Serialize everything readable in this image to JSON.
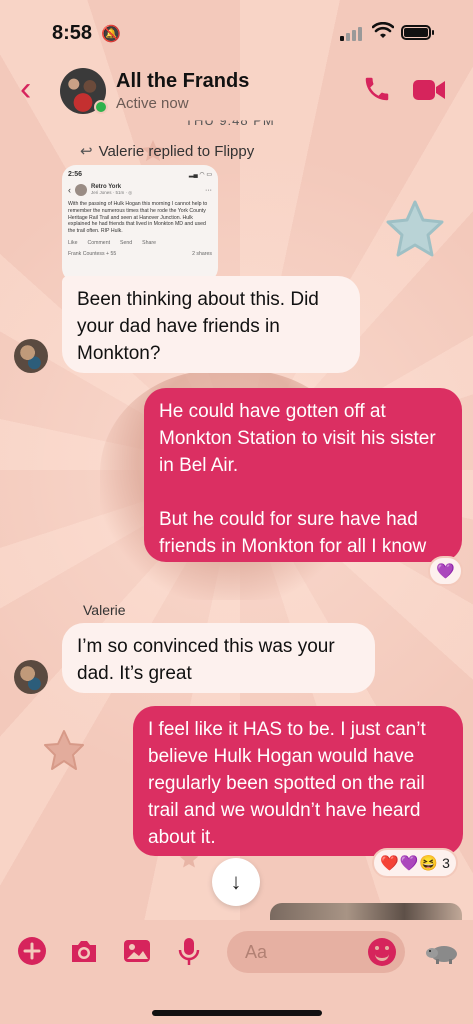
{
  "status_bar": {
    "time": "8:58",
    "bell": "🔕",
    "wifi": "📶"
  },
  "header": {
    "back": "‹",
    "title": "All the Frands",
    "subtitle": "Active now",
    "colors": {
      "accent": "#d6245c",
      "online": "#2fb24c"
    }
  },
  "cutoff_timestamp": "THU 9:48 PM",
  "reply_label": "Valerie replied to Flippy",
  "reply_arrow": "↩",
  "quoted_post": {
    "time": "2:56",
    "page_name": "Retro York",
    "author_line": "Jeri Jones · 51m · ◎",
    "menu": "···",
    "back": "‹",
    "text": "With the passing of Hulk Hogan this morning I cannot help to remember the numerous times that he rode the York County Heritage Rail Trail and seen at Hanover Junction. Hulk explained he had friends that lived in Monkton MD and used the trail often.  RIP Hulk.",
    "actions": [
      "Like",
      "Comment",
      "Send",
      "Share"
    ],
    "reactions": "Frank Countess + 55",
    "shares": "2 shares"
  },
  "messages": [
    {
      "from": "Valerie",
      "direction": "in",
      "text": "Been thinking about this. Did your dad have friends in Monkton?"
    },
    {
      "direction": "out",
      "text": "He could have gotten off at Monkton Station to visit his sister in Bel Air.\n\nBut he could for sure have had friends in Monkton for all I know",
      "reactions": [
        "💜"
      ]
    },
    {
      "sender_label": "Valerie",
      "direction": "in",
      "text": "I’m so convinced this was your dad. It’s great"
    },
    {
      "direction": "out",
      "text": "I feel like it HAS to be. I just can’t believe Hulk Hogan would have regularly been spotted on the rail trail and we wouldn’t have heard about it.",
      "reactions": [
        "❤️",
        "💜",
        "😆"
      ],
      "reaction_count": "3"
    }
  ],
  "scroll_down": "↓",
  "composer": {
    "placeholder": "Aa",
    "icons": [
      "plus-icon",
      "camera-icon",
      "image-icon",
      "mic-icon",
      "emoji-icon",
      "hippo-sticker-icon"
    ]
  }
}
